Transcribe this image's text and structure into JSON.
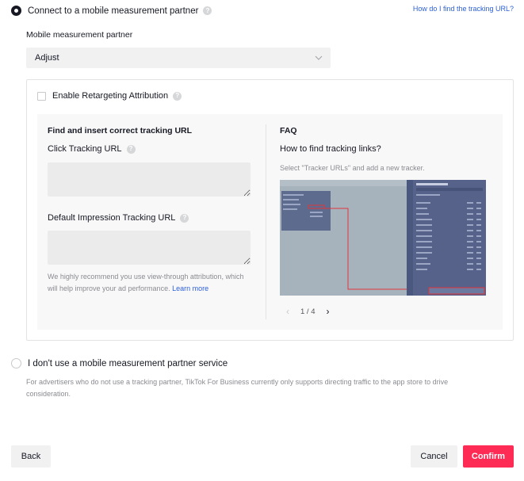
{
  "partner_option": {
    "label": "Connect to a mobile measurement partner",
    "help_link": "How do I find the tracking URL?"
  },
  "partner_select": {
    "label": "Mobile measurement partner",
    "value": "Adjust"
  },
  "retargeting": {
    "label": "Enable Retargeting Attribution"
  },
  "tracking": {
    "section_title": "Find and insert correct tracking URL",
    "click_label": "Click Tracking URL",
    "impression_label": "Default Impression Tracking URL",
    "hint_text": "We highly recommend you use view-through attribution, which will help improve your ad performance.",
    "learn_more": "Learn more"
  },
  "faq": {
    "title": "FAQ",
    "question": "How to find tracking links?",
    "description": "Select \"Tracker URLs\" and add a new tracker.",
    "pager": "1 / 4"
  },
  "no_partner_option": {
    "label": "I don't use a mobile measurement partner service",
    "description": "For advertisers who do not use a tracking partner, TikTok For Business currently only supports directing traffic to the app store to drive consideration."
  },
  "footer": {
    "back": "Back",
    "cancel": "Cancel",
    "confirm": "Confirm"
  },
  "colors": {
    "accent": "#fe2c55",
    "link": "#2b5fd9"
  }
}
